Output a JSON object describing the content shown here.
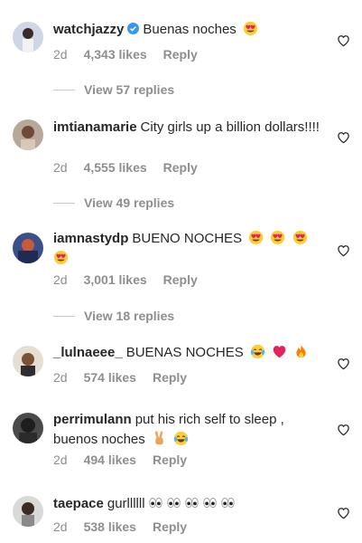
{
  "comments": [
    {
      "username": "watchjazzy",
      "verified": true,
      "text": "Buenas noches",
      "emojis": [
        "heart-eyes"
      ],
      "age": "2d",
      "likes": "4,343 likes",
      "reply": "Reply",
      "view_replies": "View 57 replies"
    },
    {
      "username": "imtianamarie",
      "text": "City girls up a billion dollars!!!!",
      "emojis": [],
      "age": "2d",
      "likes": "4,555 likes",
      "reply": "Reply",
      "view_replies": "View 49 replies"
    },
    {
      "username": "iamnastydp",
      "text": "BUENO NOCHES",
      "emojis": [
        "heart-eyes",
        "heart-eyes",
        "heart-eyes",
        "heart-eyes"
      ],
      "age": "2d",
      "likes": "3,001 likes",
      "reply": "Reply",
      "view_replies": "View 18 replies"
    },
    {
      "username": "_lulnaeee_",
      "text": "BUENAS NOCHES",
      "emojis": [
        "tears-of-joy",
        "red-heart",
        "fire"
      ],
      "age": "2d",
      "likes": "574 likes",
      "reply": "Reply"
    },
    {
      "username": "perrimulann",
      "text": "put his rich self to sleep , buenos noches",
      "emojis": [
        "victory-hand",
        "tears-of-joy"
      ],
      "age": "2d",
      "likes": "494 likes",
      "reply": "Reply"
    },
    {
      "username": "taepace",
      "text": "gurllllll",
      "emojis": [
        "eyes",
        "eyes",
        "eyes",
        "eyes",
        "eyes"
      ],
      "age": "2d",
      "likes": "538 likes",
      "reply": "Reply"
    }
  ],
  "colors": {
    "text": "#262626",
    "secondary": "#8e8e8e",
    "verified": "#3897f0"
  }
}
